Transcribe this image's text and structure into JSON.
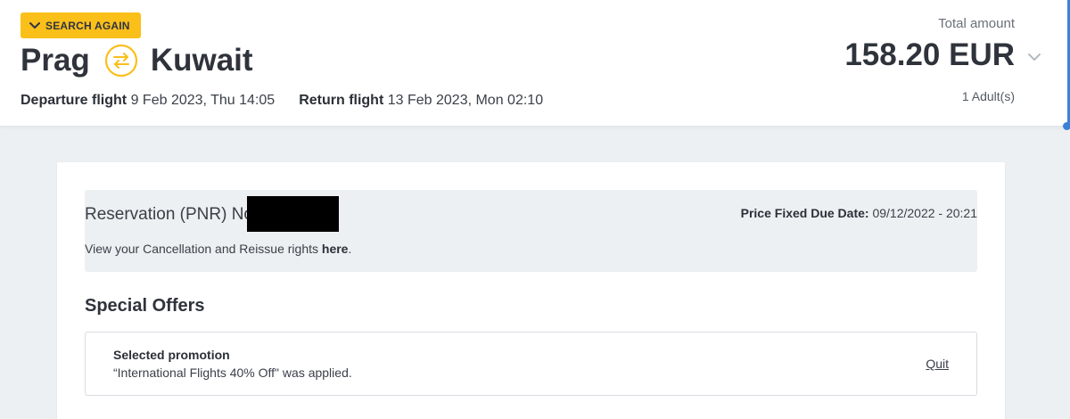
{
  "header": {
    "search_again_label": "SEARCH AGAIN",
    "origin": "Prag",
    "destination": "Kuwait",
    "departure": {
      "label": "Departure flight",
      "value": "9 Feb 2023, Thu 14:05"
    },
    "return": {
      "label": "Return flight",
      "value": "13 Feb 2023, Mon 02:10"
    },
    "total": {
      "label": "Total amount",
      "amount": "158.20 EUR",
      "passengers": "1 Adult(s)"
    }
  },
  "colors": {
    "accent_yellow": "#fbbf1a",
    "page_background": "#edf0f3",
    "scroll_accent": "#3b82d6"
  },
  "reservation": {
    "pnr_label": "Reservation (PNR) No:",
    "due_date_label": "Price Fixed Due Date:",
    "due_date_value": " 09/12/2022 - 20:21",
    "rights_text": "View your Cancellation and Reissue rights ",
    "rights_link": "here",
    "rights_suffix": "."
  },
  "special_offers": {
    "title": "Special Offers",
    "promotion": {
      "title": "Selected promotion",
      "description": "“International Flights 40% Off\" was applied.",
      "quit_label": "Quit"
    }
  },
  "icons": {
    "search_again": "chevron-down-icon",
    "route_swap": "swap-arrows-icon",
    "total_toggle": "chevron-down-icon"
  }
}
